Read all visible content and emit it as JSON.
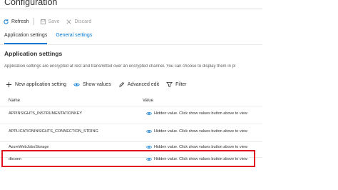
{
  "title": "Configuration",
  "toolbar": {
    "refresh": "Refresh",
    "save": "Save",
    "discard": "Discard"
  },
  "tabs": [
    {
      "label": "Application settings",
      "active": true
    },
    {
      "label": "General settings",
      "active": false
    }
  ],
  "section": {
    "heading": "Application settings",
    "description": "Application settings are encrypted at rest and transmitted over an encrypted channel. You can choose to display them in pl"
  },
  "actions": {
    "new_setting": "New application setting",
    "show_values": "Show values",
    "advanced_edit": "Advanced edit",
    "filter": "Filter"
  },
  "table": {
    "columns": [
      "Name",
      "Value"
    ],
    "rows": [
      {
        "name": "APPINSIGHTS_INSTRUMENTATIONKEY",
        "value": "Hidden value. Click show values button above to view"
      },
      {
        "name": "APPLICATIONINSIGHTS_CONNECTION_STRING",
        "value": "Hidden value. Click show values button above to view"
      },
      {
        "name": "AzureWebJobsStorage",
        "value": "Hidden value. Click show values button above to view"
      },
      {
        "name": "dbconn",
        "value": "Hidden value. Click show values button above to view"
      }
    ]
  },
  "colors": {
    "accent": "#0078d4",
    "highlight": "#e0141e"
  }
}
